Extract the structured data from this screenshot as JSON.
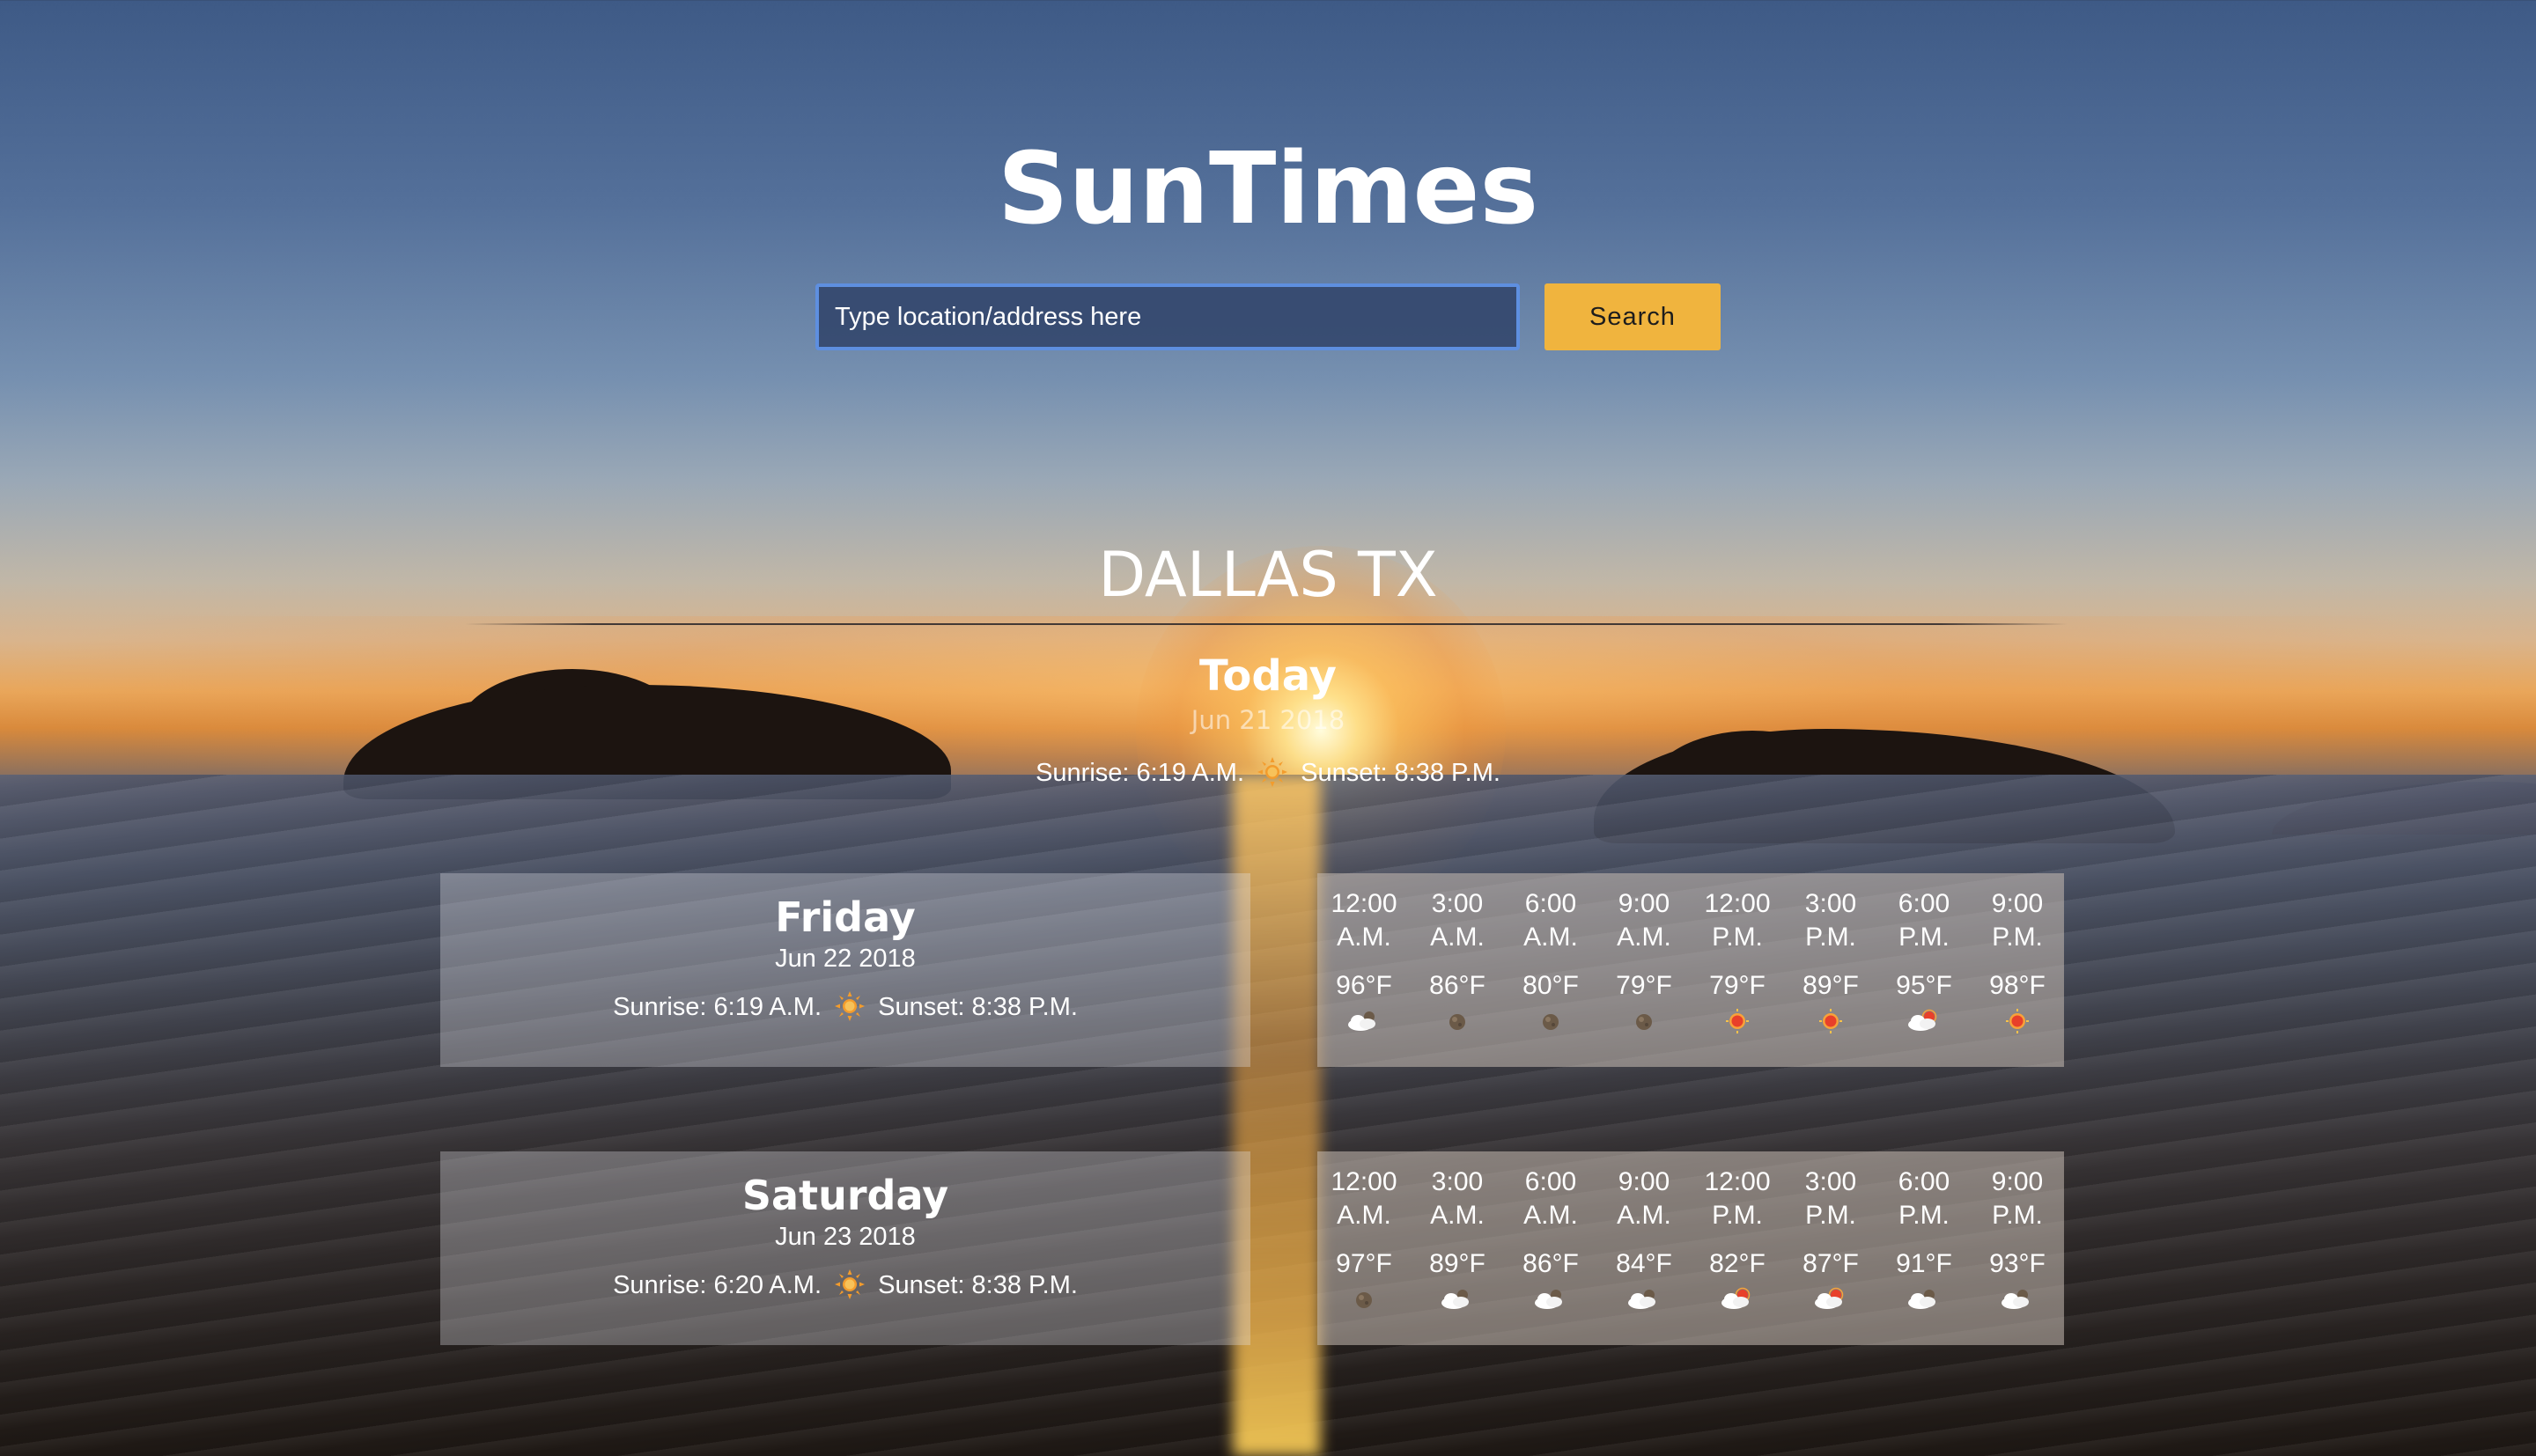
{
  "app": {
    "title": "SunTimes"
  },
  "search": {
    "placeholder": "Type location/address here",
    "button_label": "Search"
  },
  "location": {
    "name": "DALLAS TX"
  },
  "today": {
    "label": "Today",
    "date": "Jun 21 2018",
    "sunrise": "Sunrise: 6:19 A.M.",
    "sunset": "Sunset: 8:38 P.M."
  },
  "days": [
    {
      "name": "Friday",
      "date": "Jun 22 2018",
      "sunrise": "Sunrise: 6:19 A.M.",
      "sunset": "Sunset: 8:38 P.M.",
      "hours": [
        {
          "time": "12:00 A.M.",
          "temp": "96°F",
          "icon": "partly-cloudy-night-icon"
        },
        {
          "time": "3:00 A.M.",
          "temp": "86°F",
          "icon": "clear-night-icon"
        },
        {
          "time": "6:00 A.M.",
          "temp": "80°F",
          "icon": "clear-night-icon"
        },
        {
          "time": "9:00 A.M.",
          "temp": "79°F",
          "icon": "clear-night-icon"
        },
        {
          "time": "12:00 P.M.",
          "temp": "79°F",
          "icon": "sunny-icon"
        },
        {
          "time": "3:00 P.M.",
          "temp": "89°F",
          "icon": "sunny-icon"
        },
        {
          "time": "6:00 P.M.",
          "temp": "95°F",
          "icon": "partly-cloudy-day-icon"
        },
        {
          "time": "9:00 P.M.",
          "temp": "98°F",
          "icon": "sunny-icon"
        }
      ]
    },
    {
      "name": "Saturday",
      "date": "Jun 23 2018",
      "sunrise": "Sunrise: 6:20 A.M.",
      "sunset": "Sunset: 8:38 P.M.",
      "hours": [
        {
          "time": "12:00 A.M.",
          "temp": "97°F",
          "icon": "clear-night-icon"
        },
        {
          "time": "3:00 A.M.",
          "temp": "89°F",
          "icon": "partly-cloudy-night-icon"
        },
        {
          "time": "6:00 A.M.",
          "temp": "86°F",
          "icon": "partly-cloudy-night-icon"
        },
        {
          "time": "9:00 A.M.",
          "temp": "84°F",
          "icon": "partly-cloudy-night-icon"
        },
        {
          "time": "12:00 P.M.",
          "temp": "82°F",
          "icon": "partly-cloudy-day-icon"
        },
        {
          "time": "3:00 P.M.",
          "temp": "87°F",
          "icon": "partly-cloudy-day-icon"
        },
        {
          "time": "6:00 P.M.",
          "temp": "91°F",
          "icon": "partly-cloudy-night-icon"
        },
        {
          "time": "9:00 P.M.",
          "temp": "93°F",
          "icon": "partly-cloudy-night-icon"
        }
      ]
    }
  ],
  "colors": {
    "search_button": "#f0b43e",
    "search_border": "#5e8fe0",
    "sun_icon": "#f39c2c"
  }
}
